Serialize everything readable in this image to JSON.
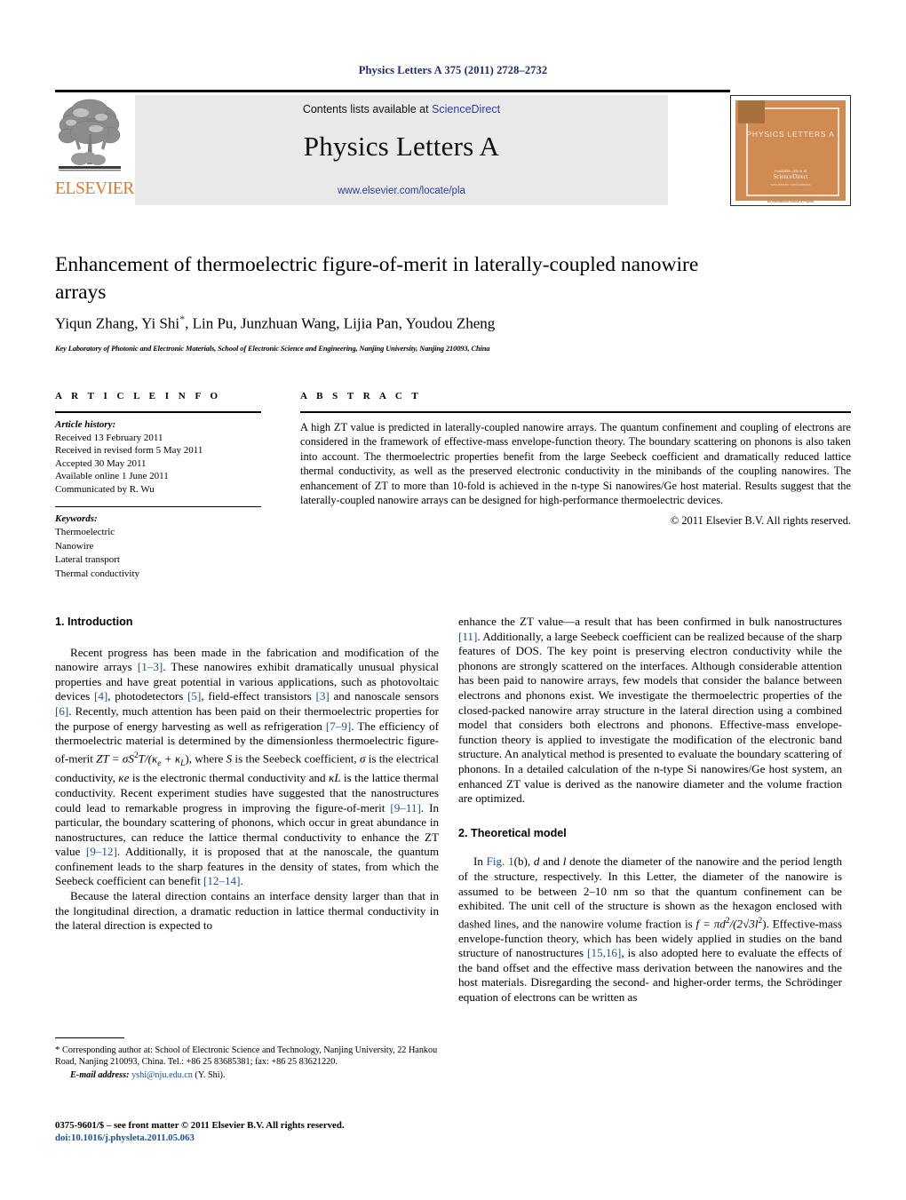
{
  "running_head": "Physics Letters A 375 (2011) 2728–2732",
  "masthead": {
    "contents_prefix": "Contents lists available at ",
    "sciencedirect": "ScienceDirect",
    "journal_title": "Physics Letters A",
    "journal_url": "www.elsevier.com/locate/pla",
    "publisher_wordmark": "ELSEVIER",
    "publisher_logo_icon": "elsevier-tree-icon",
    "cover": {
      "title": "PHYSICS LETTERS A",
      "foot1": "Available online at",
      "foot2": "ScienceDirect",
      "foot3": "www.elsevier.com/locate/pla",
      "bottom": "An International Journal of Physics",
      "accent_color": "#cf8b52"
    },
    "accent_orange": "#E87722",
    "link_blue": "#2b3f9e"
  },
  "article": {
    "title": "Enhancement of thermoelectric figure-of-merit in laterally-coupled nanowire arrays",
    "authors": "Yiqun Zhang, Yi Shi",
    "authors_tail": ", Lin Pu, Junzhuan Wang, Lijia Pan, Youdou Zheng",
    "corresponding_marker": "*",
    "affiliation": "Key Laboratory of Photonic and Electronic Materials, School of Electronic Science and Engineering, Nanjing University, Nanjing 210093, China"
  },
  "info": {
    "heading": "A R T I C L E    I N F O",
    "history_label": "Article history:",
    "history": [
      "Received 13 February 2011",
      "Received in revised form 5 May 2011",
      "Accepted 30 May 2011",
      "Available online 1 June 2011",
      "Communicated by R. Wu"
    ],
    "keywords_label": "Keywords:",
    "keywords": [
      "Thermoelectric",
      "Nanowire",
      "Lateral transport",
      "Thermal conductivity"
    ]
  },
  "abstract": {
    "heading": "A B S T R A C T",
    "text": "A high ZT value is predicted in laterally-coupled nanowire arrays. The quantum confinement and coupling of electrons are considered in the framework of effective-mass envelope-function theory. The boundary scattering on phonons is also taken into account. The thermoelectric properties benefit from the large Seebeck coefficient and dramatically reduced lattice thermal conductivity, as well as the preserved electronic conductivity in the minibands of the coupling nanowires. The enhancement of ZT to more than 10-fold is achieved in the n-type Si nanowires/Ge host material. Results suggest that the laterally-coupled nanowire arrays can be designed for high-performance thermoelectric devices.",
    "copyright": "© 2011 Elsevier B.V. All rights reserved."
  },
  "sections": {
    "intro_heading": "1. Introduction",
    "theory_heading": "2. Theoretical model"
  },
  "left_column": {
    "p1_a": "Recent progress has been made in the fabrication and modification of the nanowire arrays ",
    "p1_r1": "[1–3]",
    "p1_b": ". These nanowires exhibit dramatically unusual physical properties and have great potential in various applications, such as photovoltaic devices ",
    "p1_r2": "[4]",
    "p1_c": ", photodetectors ",
    "p1_r3": "[5]",
    "p1_d": ", field-effect transistors ",
    "p1_r4": "[3]",
    "p1_e": " and nanoscale sensors ",
    "p1_r5": "[6]",
    "p1_f": ". Recently, much attention has been paid on their thermoelectric properties for the purpose of energy harvesting as well as refrigeration ",
    "p1_r6": "[7–9]",
    "p1_g": ". The efficiency of thermoelectric material is determined by the dimensionless thermoelectric figure-of-merit ",
    "p1_math_zt": "ZT",
    "p1_math_eq": " = σS",
    "p1_math_sup": "2",
    "p1_math_t": "T",
    "p1_math_den": "/(κ",
    "p1_math_sub_e": "e",
    "p1_math_plus": " + κ",
    "p1_math_sub_l": "L",
    "p1_math_close": "),",
    "p1_h": " where ",
    "p1_S": "S",
    "p1_i": " is the Seebeck coefficient, ",
    "p1_sigma": "σ",
    "p1_j": " is the electrical conductivity, ",
    "p1_kappa_e": "κe",
    "p1_k": " is the electronic thermal conductivity and ",
    "p1_kappa_l": "κL",
    "p1_l": " is the lattice thermal conductivity. Recent experiment studies have suggested that the nanostructures could lead to remarkable progress in improving the figure-of-merit ",
    "p1_r7": "[9–11]",
    "p1_m": ". In particular, the boundary scattering of phonons, which occur in great abundance in nanostructures, can reduce the lattice thermal conductivity to enhance the ZT value ",
    "p1_r8": "[9–12]",
    "p1_n": ". Additionally, it is proposed that at the nanoscale, the quantum confinement leads to the sharp features in the density of states, from which the Seebeck coefficient can benefit ",
    "p1_r9": "[12–14]",
    "p1_o": ".",
    "p2": "Because the lateral direction contains an interface density larger than that in the longitudinal direction, a dramatic reduction in lattice thermal conductivity in the lateral direction is expected to"
  },
  "right_column": {
    "p1_a": "enhance the ZT value—a result that has been confirmed in bulk nanostructures ",
    "p1_r1": "[11]",
    "p1_b": ". Additionally, a large Seebeck coefficient can be realized because of the sharp features of DOS. The key point is preserving electron conductivity while the phonons are strongly scattered on the interfaces. Although considerable attention has been paid to nanowire arrays, few models that consider the balance between electrons and phonons exist. We investigate the thermoelectric properties of the closed-packed nanowire array structure in the lateral direction using a combined model that considers both electrons and phonons. Effective-mass envelope-function theory is applied to investigate the modification of the electronic band structure. An analytical method is presented to evaluate the boundary scattering of phonons. In a detailed calculation of the n-type Si nanowires/Ge host system, an enhanced ZT value is derived as the nanowire diameter and the volume fraction are optimized.",
    "p2_a": "In ",
    "p2_fig": "Fig. 1",
    "p2_b": "(b), ",
    "p2_d": "d",
    "p2_c": " and ",
    "p2_l": "l",
    "p2_e": " denote the diameter of the nanowire and the period length of the structure, respectively. In this Letter, the diameter of the nanowire is assumed to be between 2–10 nm so that the quantum confinement can be exhibited. The unit cell of the structure is shown as the hexagon enclosed with dashed lines, and the nanowire volume fraction is ",
    "p2_f": "f",
    "p2_eq": " = πd",
    "p2_sup2": "2",
    "p2_frac": "/(2√3l",
    "p2_sup3": "2",
    "p2_close": ")",
    "p2_g": ". Effective-mass envelope-function theory, which has been widely applied in studies on the band structure of nanostructures ",
    "p2_r2": "[15,16]",
    "p2_h": ", is also adopted here to evaluate the effects of the band offset and the effective mass derivation between the nanowires and the host materials. Disregarding the second- and higher-order terms, the Schrödinger equation of electrons can be written as"
  },
  "footnote": {
    "marker": "*",
    "text": " Corresponding author at: School of Electronic Science and Technology, Nanjing University, 22 Hankou Road, Nanjing 210093, China. Tel.: +86 25 83685381; fax: +86 25 83621220.",
    "email_label": "E-mail address:",
    "email": "yshi@nju.edu.cn",
    "email_suffix": " (Y. Shi)."
  },
  "issn": {
    "line1": "0375-9601/$ – see front matter © 2011 Elsevier B.V. All rights reserved.",
    "doi": "doi:10.1016/j.physleta.2011.05.063"
  }
}
